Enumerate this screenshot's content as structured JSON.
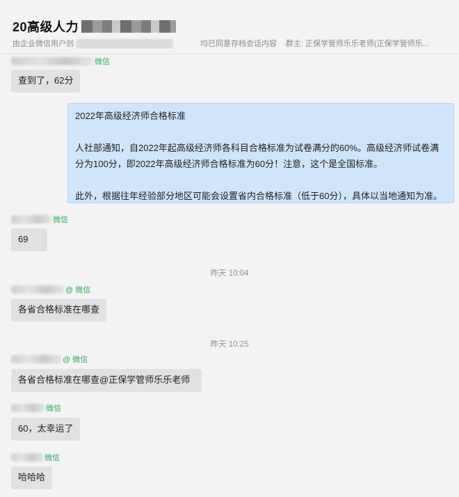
{
  "header": {
    "title": "20高级人力",
    "subtitle_prefix": "由企业微信用户创",
    "subtitle_mid": "均已同意存档会话内容",
    "subtitle_owner": "·群主: 正保学管师乐乐老师(正保学管师乐..."
  },
  "sender_tag": "微信",
  "sender_tag_at": "@ 微信",
  "messages": [
    {
      "text": "查到了，62分"
    },
    {
      "text": "69"
    },
    {
      "text": "各省合格标准在哪查"
    },
    {
      "text": "各省合格标准在哪查@正保学管师乐乐老师"
    },
    {
      "text": "60，太幸运了"
    },
    {
      "text": "哈哈哈"
    }
  ],
  "notice": {
    "title": "2022年高级经济师合格标准",
    "line1": "人社部通知，自2022年起高级经济师各科目合格标准为试卷满分的60%。高级经济师试卷满",
    "line2": "分为100分，即2022年高级经济师合格标准为60分！注意，这个是全国标准。",
    "line3": "此外，根据往年经验部分地区可能会设置省内合格标准（低于60分），具体以当地通知为准。"
  },
  "timestamps": [
    "昨天 10:04",
    "昨天 10:25"
  ],
  "colors": {
    "wechat_tag": "#3aa85a",
    "self_bubble": "#cfe5fb",
    "other_bubble": "#e1e1e4"
  }
}
